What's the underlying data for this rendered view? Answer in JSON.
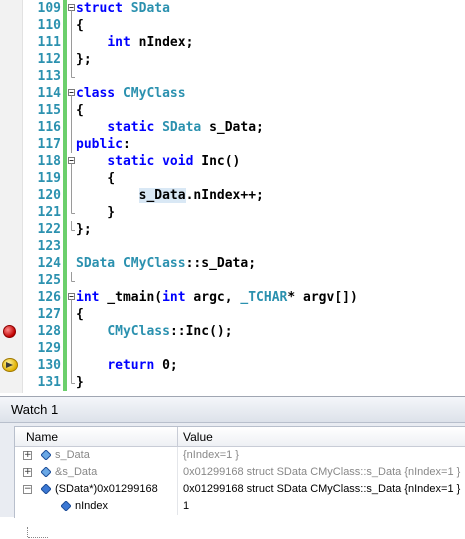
{
  "editor": {
    "lines": [
      {
        "num": "109",
        "fold": "start",
        "tokens": [
          {
            "t": "struct",
            "c": "keyword"
          },
          {
            "t": " SData",
            "c": "type"
          }
        ]
      },
      {
        "num": "110",
        "fold": "mid",
        "tokens": [
          {
            "t": "{",
            "c": "plain"
          }
        ]
      },
      {
        "num": "111",
        "fold": "mid",
        "tokens": [
          {
            "t": "    ",
            "c": "plain"
          },
          {
            "t": "int",
            "c": "keyword"
          },
          {
            "t": " nIndex;",
            "c": "plain"
          }
        ]
      },
      {
        "num": "112",
        "fold": "mid",
        "tokens": [
          {
            "t": "};",
            "c": "plain"
          }
        ]
      },
      {
        "num": "113",
        "fold": "end",
        "tokens": []
      },
      {
        "num": "114",
        "fold": "start",
        "tokens": [
          {
            "t": "class",
            "c": "keyword"
          },
          {
            "t": " CMyClass",
            "c": "type"
          }
        ]
      },
      {
        "num": "115",
        "fold": "mid",
        "tokens": [
          {
            "t": "{",
            "c": "plain"
          }
        ]
      },
      {
        "num": "116",
        "fold": "mid",
        "tokens": [
          {
            "t": "    ",
            "c": "plain"
          },
          {
            "t": "static",
            "c": "keyword"
          },
          {
            "t": " ",
            "c": "plain"
          },
          {
            "t": "SData",
            "c": "type"
          },
          {
            "t": " s_Data;",
            "c": "plain"
          }
        ]
      },
      {
        "num": "117",
        "fold": "mid",
        "tokens": [
          {
            "t": "public",
            "c": "keyword"
          },
          {
            "t": ":",
            "c": "plain"
          }
        ]
      },
      {
        "num": "118",
        "fold": "start",
        "tokens": [
          {
            "t": "    ",
            "c": "plain"
          },
          {
            "t": "static",
            "c": "keyword"
          },
          {
            "t": " ",
            "c": "plain"
          },
          {
            "t": "void",
            "c": "keyword"
          },
          {
            "t": " Inc()",
            "c": "plain"
          }
        ]
      },
      {
        "num": "119",
        "fold": "mid",
        "tokens": [
          {
            "t": "    {",
            "c": "plain"
          }
        ]
      },
      {
        "num": "120",
        "fold": "mid",
        "tokens": [
          {
            "t": "        ",
            "c": "plain"
          },
          {
            "t": "s_Data",
            "c": "highlight"
          },
          {
            "t": ".nIndex++;",
            "c": "plain"
          }
        ]
      },
      {
        "num": "121",
        "fold": "end",
        "tokens": [
          {
            "t": "    }",
            "c": "plain"
          }
        ]
      },
      {
        "num": "122",
        "fold": "end",
        "tokens": [
          {
            "t": "};",
            "c": "plain"
          }
        ]
      },
      {
        "num": "123",
        "fold": "none",
        "tokens": []
      },
      {
        "num": "124",
        "fold": "none",
        "tokens": [
          {
            "t": "SData",
            "c": "type"
          },
          {
            "t": " ",
            "c": "plain"
          },
          {
            "t": "CMyClass",
            "c": "type"
          },
          {
            "t": "::s_Data;",
            "c": "plain"
          }
        ]
      },
      {
        "num": "125",
        "fold": "end",
        "tokens": []
      },
      {
        "num": "126",
        "fold": "start",
        "tokens": [
          {
            "t": "int",
            "c": "keyword"
          },
          {
            "t": " _tmain(",
            "c": "plain"
          },
          {
            "t": "int",
            "c": "keyword"
          },
          {
            "t": " argc, ",
            "c": "plain"
          },
          {
            "t": "_TCHAR",
            "c": "type"
          },
          {
            "t": "* argv[])",
            "c": "plain"
          }
        ]
      },
      {
        "num": "127",
        "fold": "mid",
        "tokens": [
          {
            "t": "{",
            "c": "plain"
          }
        ]
      },
      {
        "num": "128",
        "fold": "mid",
        "marker": "breakpoint",
        "tokens": [
          {
            "t": "    ",
            "c": "plain"
          },
          {
            "t": "CMyClass",
            "c": "type"
          },
          {
            "t": "::Inc();",
            "c": "plain"
          }
        ]
      },
      {
        "num": "129",
        "fold": "mid",
        "tokens": []
      },
      {
        "num": "130",
        "fold": "mid",
        "marker": "current",
        "tokens": [
          {
            "t": "    ",
            "c": "plain"
          },
          {
            "t": "return",
            "c": "keyword"
          },
          {
            "t": " 0;",
            "c": "plain"
          }
        ]
      },
      {
        "num": "131",
        "fold": "end",
        "tokens": [
          {
            "t": "}",
            "c": "plain"
          }
        ]
      }
    ]
  },
  "watch": {
    "title": "Watch 1",
    "columns": {
      "name": "Name",
      "value": "Value"
    },
    "rows": [
      {
        "expander": "+",
        "name": "s_Data",
        "value": "{nIndex=1 }",
        "state": "stale",
        "icon": "field-icon",
        "indent": 0
      },
      {
        "expander": "+",
        "name": "&s_Data",
        "value": "0x01299168 struct SData CMyClass::s_Data {nIndex=1 }",
        "state": "stale",
        "icon": "field-icon",
        "indent": 0
      },
      {
        "expander": "−",
        "name": "(SData*)0x01299168",
        "value": "0x01299168 struct SData CMyClass::s_Data {nIndex=1 }",
        "state": "live",
        "icon": "variable-icon",
        "indent": 0
      },
      {
        "expander": "",
        "name": "nIndex",
        "value": "1",
        "state": "live",
        "icon": "variable-icon",
        "indent": 1
      }
    ]
  },
  "colors": {
    "keyword": "#0000ff",
    "type": "#2b91af",
    "line_number": "#2b91af",
    "change_bar": "#6ccf6c",
    "breakpoint": "#c00000",
    "stale_text": "#888888"
  }
}
